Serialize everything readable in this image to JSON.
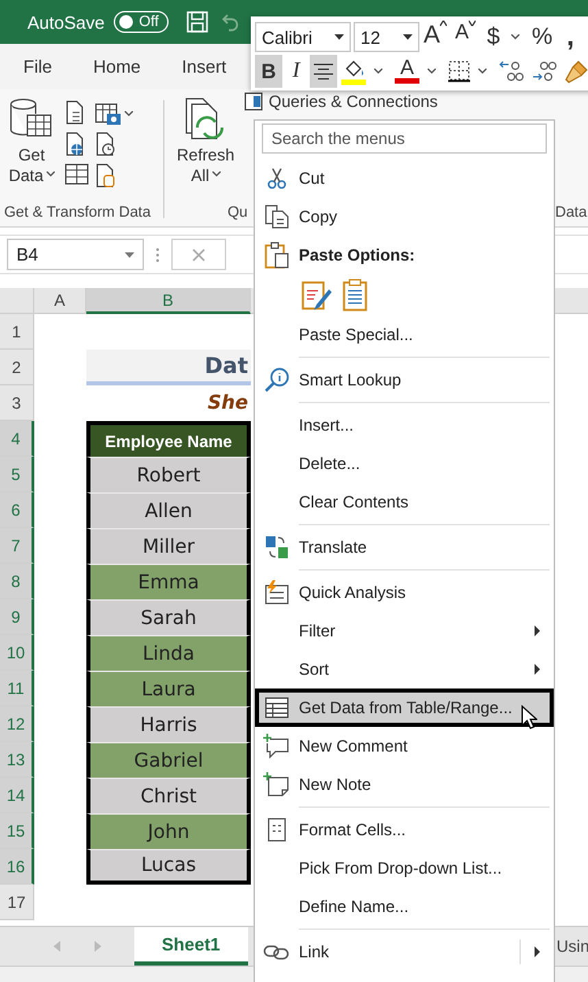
{
  "title_bar": {
    "autosave_label": "AutoSave",
    "autosave": {
      "label": "Off",
      "on": false
    }
  },
  "ribbon": {
    "tabs": [
      {
        "label": "File",
        "selected": false
      },
      {
        "label": "Home",
        "selected": false
      },
      {
        "label": "Insert",
        "selected": false
      }
    ],
    "get_data": {
      "line1": "Get",
      "line2": "Data"
    },
    "refresh_all": {
      "line1": "Refresh",
      "line2": "All"
    },
    "queries_connections": "Queries & Connections",
    "groups": [
      "Get & Transform Data",
      "Qu",
      "Data"
    ]
  },
  "formula_bar": {
    "name_box": "B4"
  },
  "sheet": {
    "columns": [
      {
        "label": "A",
        "selected": false
      },
      {
        "label": "B",
        "selected": true
      }
    ],
    "rows": [
      {
        "label": "1",
        "selected": false
      },
      {
        "label": "2",
        "selected": false
      },
      {
        "label": "3",
        "selected": false
      },
      {
        "label": "4",
        "selected": true
      },
      {
        "label": "5",
        "selected": true
      },
      {
        "label": "6",
        "selected": true
      },
      {
        "label": "7",
        "selected": true
      },
      {
        "label": "8",
        "selected": true
      },
      {
        "label": "9",
        "selected": true
      },
      {
        "label": "10",
        "selected": true
      },
      {
        "label": "11",
        "selected": true
      },
      {
        "label": "12",
        "selected": true
      },
      {
        "label": "13",
        "selected": true
      },
      {
        "label": "14",
        "selected": true
      },
      {
        "label": "15",
        "selected": true
      },
      {
        "label": "16",
        "selected": true
      },
      {
        "label": "17",
        "selected": false
      }
    ],
    "title": "Dat",
    "subtitle": "She",
    "table_header": "Employee Name",
    "names": [
      {
        "text": "Robert",
        "highlighted": false
      },
      {
        "text": "Allen",
        "highlighted": false
      },
      {
        "text": "Miller",
        "highlighted": false
      },
      {
        "text": "Emma",
        "highlighted": true
      },
      {
        "text": "Sarah",
        "highlighted": false
      },
      {
        "text": "Linda",
        "highlighted": true
      },
      {
        "text": "Laura",
        "highlighted": true
      },
      {
        "text": "Harris",
        "highlighted": false
      },
      {
        "text": "Gabriel",
        "highlighted": true
      },
      {
        "text": "Christ",
        "highlighted": false
      },
      {
        "text": "John",
        "highlighted": true
      },
      {
        "text": "Lucas",
        "highlighted": false
      }
    ]
  },
  "sheet_tabs": [
    {
      "label": "Sheet1",
      "selected": true
    },
    {
      "label": "Usin",
      "selected": false
    }
  ],
  "mini_toolbar": {
    "font": "Calibri",
    "size": "12",
    "row1": [
      {
        "kind": "grow",
        "label": "A",
        "dropdown": false,
        "selected": false
      },
      {
        "kind": "shrink",
        "label": "A",
        "dropdown": false,
        "selected": false
      },
      {
        "kind": "text",
        "label": "$",
        "dropdown": true,
        "selected": false
      },
      {
        "kind": "text",
        "label": "%",
        "dropdown": false,
        "selected": false
      },
      {
        "kind": "text",
        "label": ",",
        "dropdown": false,
        "selected": false
      }
    ],
    "row2": [
      {
        "kind": "text",
        "label": "B",
        "dropdown": false,
        "selected": true
      },
      {
        "kind": "text",
        "label": "I",
        "dropdown": false,
        "selected": false
      },
      {
        "kind": "align",
        "dropdown": false,
        "selected": true
      },
      {
        "kind": "fill",
        "dropdown": true,
        "selected": false
      },
      {
        "kind": "fontcolor",
        "label": "A",
        "dropdown": true,
        "selected": false
      },
      {
        "kind": "borders",
        "dropdown": true,
        "selected": false
      },
      {
        "kind": "incdec",
        "dropdown": false,
        "selected": false
      },
      {
        "kind": "decdec",
        "dropdown": false,
        "selected": false
      },
      {
        "kind": "painter",
        "dropdown": false,
        "selected": false
      }
    ]
  },
  "context_menu": {
    "search_placeholder": "Search the menus",
    "sections": [
      [
        {
          "kind": "item",
          "label": "Cut",
          "submenu": false,
          "selected": false
        },
        {
          "kind": "item",
          "label": "Copy",
          "submenu": false,
          "selected": false
        },
        {
          "kind": "header",
          "label": "Paste Options:"
        },
        {
          "kind": "paste_icons"
        },
        {
          "kind": "item",
          "label": "Paste Special...",
          "submenu": false,
          "selected": false
        }
      ],
      [
        {
          "kind": "item",
          "label": "Smart Lookup",
          "submenu": false,
          "selected": false
        }
      ],
      [
        {
          "kind": "item",
          "label": "Insert...",
          "submenu": false,
          "selected": false
        },
        {
          "kind": "item",
          "label": "Delete...",
          "submenu": false,
          "selected": false
        },
        {
          "kind": "item",
          "label": "Clear Contents",
          "submenu": false,
          "selected": false
        }
      ],
      [
        {
          "kind": "item",
          "label": "Translate",
          "submenu": false,
          "selected": false
        }
      ],
      [
        {
          "kind": "item",
          "label": "Quick Analysis",
          "submenu": false,
          "selected": false
        },
        {
          "kind": "item",
          "label": "Filter",
          "submenu": true,
          "selected": false
        },
        {
          "kind": "item",
          "label": "Sort",
          "submenu": true,
          "selected": false
        },
        {
          "kind": "item",
          "label": "Get Data from Table/Range...",
          "submenu": false,
          "selected": true
        },
        {
          "kind": "item",
          "label": "New Comment",
          "submenu": false,
          "selected": false
        },
        {
          "kind": "item",
          "label": "New Note",
          "submenu": false,
          "selected": false
        }
      ],
      [
        {
          "kind": "item",
          "label": "Format Cells...",
          "submenu": false,
          "selected": false
        },
        {
          "kind": "item",
          "label": "Pick From Drop-down List...",
          "submenu": false,
          "selected": false
        },
        {
          "kind": "item",
          "label": "Define Name...",
          "submenu": false,
          "selected": false
        }
      ],
      [
        {
          "kind": "item",
          "label": "Link",
          "submenu": true,
          "selected": false
        }
      ]
    ]
  }
}
